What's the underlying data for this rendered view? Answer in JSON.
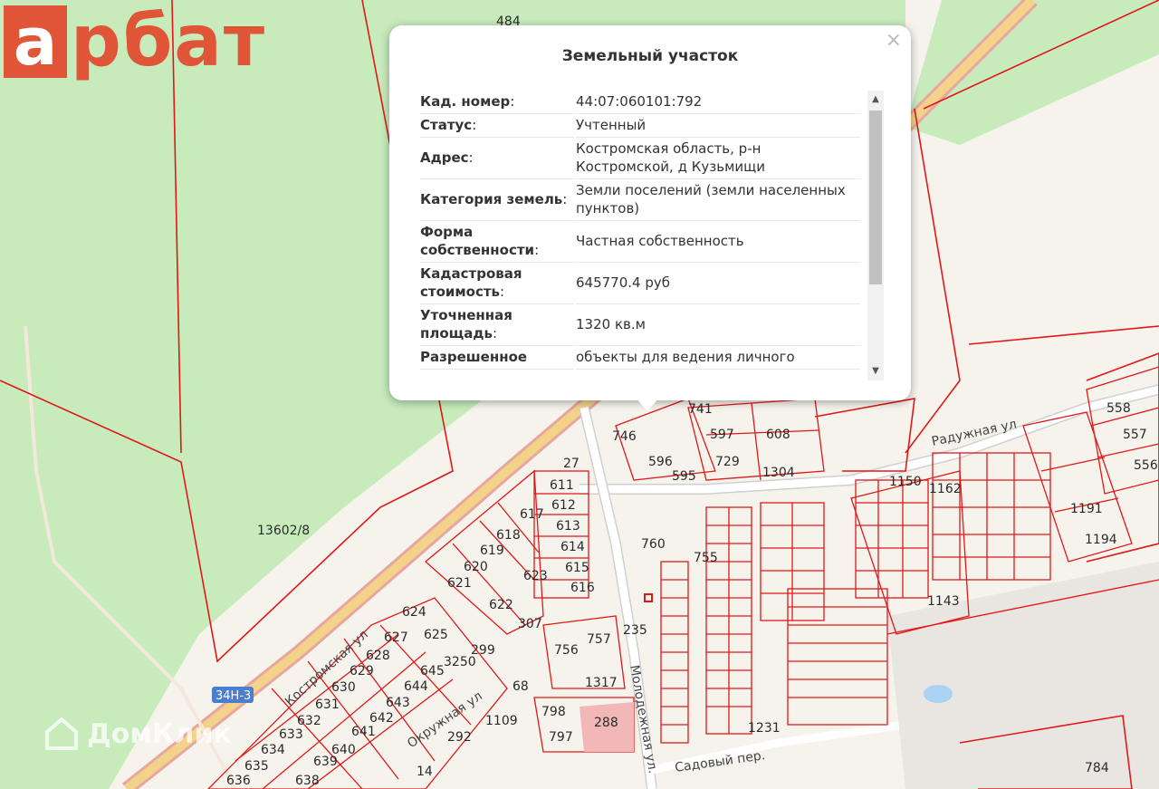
{
  "brand": {
    "logo_first": "а",
    "logo_rest": "рбат",
    "color": "#e05437"
  },
  "watermark": {
    "text": "ДомКлик"
  },
  "map": {
    "colors": {
      "forest": "#c7ebbb",
      "ground": "#f6f3ec",
      "parcel_line": "#e01818",
      "road": "#f3d38a"
    },
    "parcel_labels": [
      "13602/8",
      "484",
      "27",
      "611",
      "612",
      "613",
      "614",
      "615",
      "616",
      "617",
      "618",
      "619",
      "620",
      "621",
      "622",
      "623",
      "624",
      "625",
      "627",
      "628",
      "629",
      "630",
      "631",
      "632",
      "633",
      "634",
      "635",
      "636",
      "638",
      "639",
      "640",
      "641",
      "642",
      "643",
      "644",
      "645",
      "3250",
      "299",
      "307",
      "756",
      "757",
      "235",
      "68",
      "1317",
      "798",
      "797",
      "288",
      "292",
      "1109",
      "14",
      "760",
      "755",
      "1231",
      "746",
      "596",
      "595",
      "597",
      "608",
      "729",
      "1304",
      "741",
      "1150",
      "1162",
      "1191",
      "1194",
      "1143",
      "558",
      "557",
      "556",
      "784"
    ],
    "road_labels": [
      "Радужная ул",
      "Молодежная ул.",
      "Садовый пер.",
      "Окружная ул",
      "Костромская ул"
    ],
    "highway_shield": "34Н-3"
  },
  "popup": {
    "title": "Земельный участок",
    "close_glyph": "×",
    "rows": [
      {
        "key": "Кад. номер",
        "value": "44:07:060101:792"
      },
      {
        "key": "Статус",
        "value": "Учтенный"
      },
      {
        "key": "Адрес",
        "value": "Костромская область, р-н Костромской, д Кузьмищи"
      },
      {
        "key": "Категория земель",
        "value": "Земли поселений (земли населенных пунктов)"
      },
      {
        "key": "Форма собственности",
        "value": "Частная собственность"
      },
      {
        "key": "Кадастровая стоимость",
        "value": "645770.4 руб"
      },
      {
        "key": "Уточненная площадь",
        "value": "1320 кв.м"
      },
      {
        "key": "Разрешенное",
        "value": "объекты для ведения личного"
      }
    ]
  }
}
